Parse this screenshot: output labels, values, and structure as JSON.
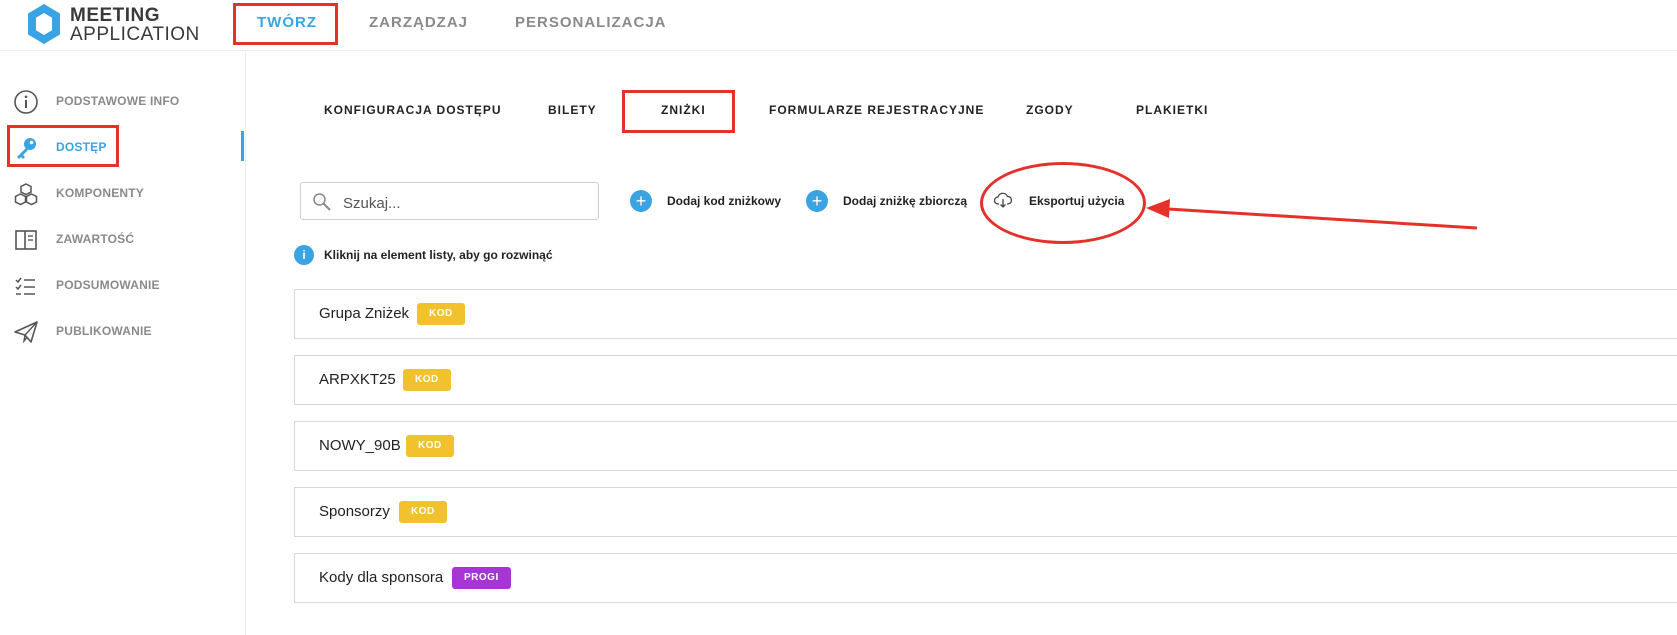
{
  "app": {
    "logo_line1": "MEETING",
    "logo_line2": "APPLICATION"
  },
  "topnav": {
    "items": [
      {
        "label": "TWÓRZ",
        "active": true
      },
      {
        "label": "ZARZĄDZAJ",
        "active": false
      },
      {
        "label": "PERSONALIZACJA",
        "active": false
      }
    ]
  },
  "sidebar": {
    "items": [
      {
        "label": "PODSTAWOWE INFO",
        "icon": "info-circle-icon"
      },
      {
        "label": "DOSTĘP",
        "icon": "key-icon",
        "active": true
      },
      {
        "label": "KOMPONENTY",
        "icon": "cubes-icon"
      },
      {
        "label": "ZAWARTOŚĆ",
        "icon": "book-layout-icon"
      },
      {
        "label": "PODSUMOWANIE",
        "icon": "checklist-icon"
      },
      {
        "label": "PUBLIKOWANIE",
        "icon": "paper-plane-icon"
      }
    ]
  },
  "tabs": [
    {
      "label": "KONFIGURACJA DOSTĘPU"
    },
    {
      "label": "BILETY"
    },
    {
      "label": "ZNIŻKI",
      "active": true
    },
    {
      "label": "FORMULARZE REJESTRACYJNE"
    },
    {
      "label": "ZGODY"
    },
    {
      "label": "PLAKIETKI"
    }
  ],
  "search": {
    "placeholder": "Szukaj..."
  },
  "actions": {
    "add_code": "Dodaj kod zniżkowy",
    "add_bulk": "Dodaj zniżkę zbiorczą",
    "export": "Eksportuj użycia"
  },
  "info": {
    "icon_glyph": "i",
    "text": "Kliknij na element listy, aby go rozwinąć"
  },
  "discounts": [
    {
      "name": "Grupa Zniżek",
      "badge": "KOD",
      "badge_color": "#f2c12e"
    },
    {
      "name": "ARPXKT25",
      "badge": "KOD",
      "badge_color": "#f2c12e"
    },
    {
      "name": "NOWY_90B",
      "badge": "KOD",
      "badge_color": "#f2c12e"
    },
    {
      "name": "Sponsorzy",
      "badge": "KOD",
      "badge_color": "#f2c12e"
    },
    {
      "name": "Kody dla sponsora",
      "badge": "PROGI",
      "badge_color": "#a735d6"
    }
  ],
  "colors": {
    "accent": "#3aa3e3",
    "annotation": "#e4322b",
    "badge_kod": "#f2c12e",
    "badge_progi": "#a735d6"
  }
}
